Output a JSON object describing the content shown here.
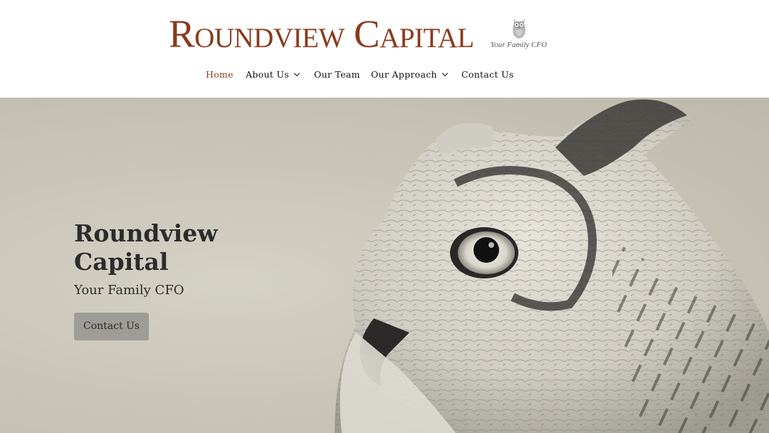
{
  "brand": {
    "name": "Roundview Capital",
    "tagline": "Your Family CFO",
    "color": "#8b3a1c"
  },
  "nav": {
    "items": [
      {
        "label": "Home",
        "active": true,
        "has_dropdown": false
      },
      {
        "label": "About Us",
        "active": false,
        "has_dropdown": true
      },
      {
        "label": "Our Team",
        "active": false,
        "has_dropdown": false
      },
      {
        "label": "Our Approach",
        "active": false,
        "has_dropdown": true
      },
      {
        "label": "Contact Us",
        "active": false,
        "has_dropdown": false
      }
    ]
  },
  "hero": {
    "title": "Roundview Capital",
    "subtitle": "Your Family CFO",
    "button_label": "Contact Us",
    "image": "owl-photo"
  }
}
